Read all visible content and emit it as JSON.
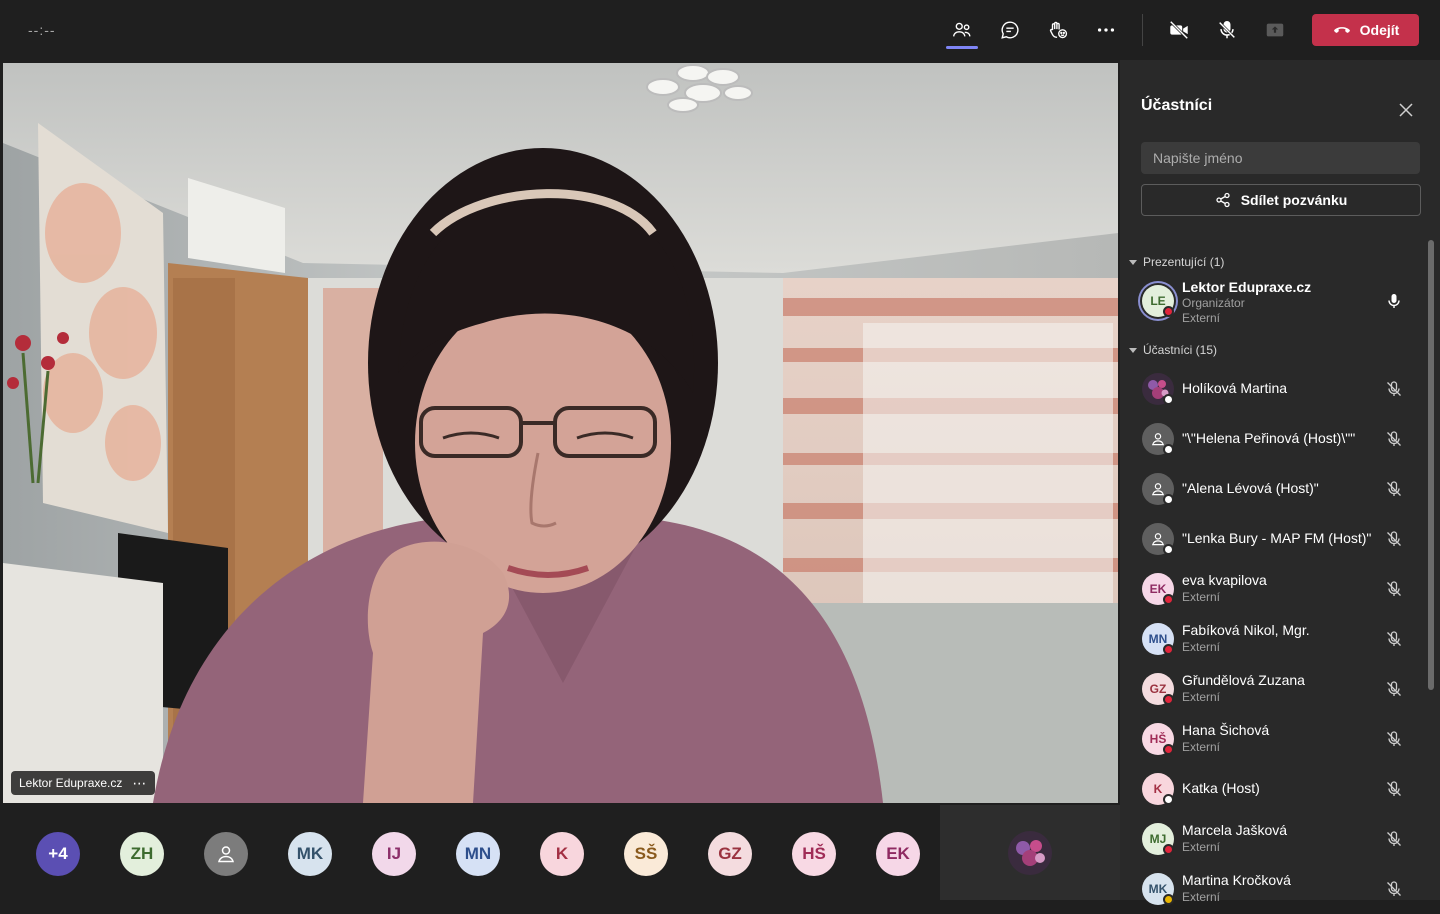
{
  "topbar": {
    "timer": "--:--",
    "icons": [
      "people-icon",
      "chat-icon",
      "reactions-icon",
      "more-icon",
      "camera-off-icon",
      "mic-off-icon",
      "share-tray-icon"
    ],
    "leave_label": "Odejít",
    "leave_color": "#c4314b",
    "accent": "#7f85f5"
  },
  "stage": {
    "speaker_name": "Lektor Edupraxe.cz",
    "more_label": "⋯"
  },
  "strip": {
    "avatars": [
      {
        "label": "+4",
        "bg": "#5b4fb3",
        "fg": "#ffffff"
      },
      {
        "label": "ZH",
        "bg": "#e3efdc",
        "fg": "#3d6b2f"
      },
      {
        "label": "",
        "bg": "#7c7c7c",
        "fg": "#ffffff",
        "icon": "person-icon"
      },
      {
        "label": "MK",
        "bg": "#d7e3ee",
        "fg": "#34526b"
      },
      {
        "label": "IJ",
        "bg": "#f2d8ea",
        "fg": "#8c2f6a"
      },
      {
        "label": "MN",
        "bg": "#d6e1f5",
        "fg": "#2e4f8c"
      },
      {
        "label": "K",
        "bg": "#f8d6dd",
        "fg": "#a33044"
      },
      {
        "label": "SŠ",
        "bg": "#faead8",
        "fg": "#8a5a1d"
      },
      {
        "label": "GZ",
        "bg": "#f4dcdf",
        "fg": "#9b3340"
      },
      {
        "label": "HŠ",
        "bg": "#f8d9e4",
        "fg": "#a02c57"
      },
      {
        "label": "EK",
        "bg": "#f6d7e7",
        "fg": "#8f2a62"
      }
    ]
  },
  "panel": {
    "title": "Účastníci",
    "search_placeholder": "Napište jméno",
    "share_label": "Sdílet pozvánku",
    "presenters_header": "Prezentující (1)",
    "attendees_header": "Účastníci (15)",
    "presenter": {
      "initials": "LE",
      "name": "Lektor Edupraxe.cz",
      "role": "Organizátor",
      "tag": "Externí"
    },
    "attendees": [
      {
        "initials": "",
        "avatar": "photo",
        "name": "Holíková Martina",
        "sub": "",
        "status": "#ffffff"
      },
      {
        "initials": "",
        "avatar": "person",
        "name": "\"\\\"Helena Peřinová (Host)\\\"\"",
        "sub": "",
        "status": "#ffffff"
      },
      {
        "initials": "",
        "avatar": "person",
        "name": "\"Alena Lévová (Host)\"",
        "sub": "",
        "status": "#ffffff"
      },
      {
        "initials": "",
        "avatar": "person",
        "name": "\"Lenka Bury - MAP FM (Host)\"",
        "sub": "",
        "status": "#ffffff"
      },
      {
        "initials": "EK",
        "avatar": "initials",
        "bg": "#f6d7e7",
        "fg": "#8f2a62",
        "name": "eva kvapilova",
        "sub": "Externí",
        "status": "#e0253b"
      },
      {
        "initials": "MN",
        "avatar": "initials",
        "bg": "#d6e1f5",
        "fg": "#2e4f8c",
        "name": "Fabíková Nikol, Mgr.",
        "sub": "Externí",
        "status": "#e0253b"
      },
      {
        "initials": "GZ",
        "avatar": "initials",
        "bg": "#f4dcdf",
        "fg": "#9b3340",
        "name": "Gřundělová Zuzana",
        "sub": "Externí",
        "status": "#e0253b"
      },
      {
        "initials": "HŠ",
        "avatar": "initials",
        "bg": "#f8d9e4",
        "fg": "#a02c57",
        "name": "Hana Šichová",
        "sub": "Externí",
        "status": "#e0253b"
      },
      {
        "initials": "K",
        "avatar": "initials",
        "bg": "#f8d6dd",
        "fg": "#a33044",
        "name": "Katka (Host)",
        "sub": "",
        "status": "#ffffff"
      },
      {
        "initials": "MJ",
        "avatar": "initials",
        "bg": "#e3efdc",
        "fg": "#3d6b2f",
        "name": "Marcela Jašková",
        "sub": "Externí",
        "status": "#e0253b"
      },
      {
        "initials": "MK",
        "avatar": "initials",
        "bg": "#d7e3ee",
        "fg": "#34526b",
        "name": "Martina Kročková",
        "sub": "Externí",
        "status": "#e8b400"
      }
    ]
  }
}
